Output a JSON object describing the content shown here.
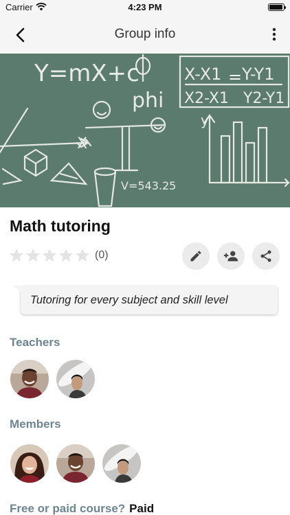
{
  "status_bar": {
    "carrier": "Carrier",
    "time": "4:23 PM"
  },
  "nav": {
    "title": "Group info",
    "back_icon": "chevron-left-icon",
    "more_icon": "more-vertical-icon"
  },
  "hero": {
    "chalk_formula_1": "Y=mX+c",
    "chalk_phi": "phi",
    "chalk_speed": "V=543.25",
    "chalk_formula_top_left": "X-X1",
    "chalk_formula_top_right": "Y-Y1",
    "chalk_formula_bottom_left": "X2-X1",
    "chalk_formula_bottom_right": "Y2-Y1",
    "chalk_x": "X",
    "chalk_y": "y"
  },
  "group": {
    "title": "Math tutoring",
    "rating_stars": 0,
    "rating_max": 5,
    "rating_count": "(0)",
    "description": "Tutoring for every subject and skill level"
  },
  "actions": [
    {
      "name": "edit",
      "icon": "pencil-icon"
    },
    {
      "name": "add-member",
      "icon": "person-add-icon"
    },
    {
      "name": "share",
      "icon": "share-icon"
    }
  ],
  "sections": {
    "teachers": "Teachers",
    "members": "Members"
  },
  "teachers": [
    {
      "avatar": "smiling-man-avatar"
    },
    {
      "avatar": "woman-hat-avatar"
    }
  ],
  "members": [
    {
      "avatar": "smiling-woman-avatar"
    },
    {
      "avatar": "smiling-man-avatar"
    },
    {
      "avatar": "woman-hat-avatar"
    }
  ],
  "course": {
    "label": "Free or paid course?",
    "value": "Paid"
  },
  "colors": {
    "chalkboard": "#5a7a6d",
    "section_header": "#6d8591",
    "action_bg": "#ebebeb"
  }
}
